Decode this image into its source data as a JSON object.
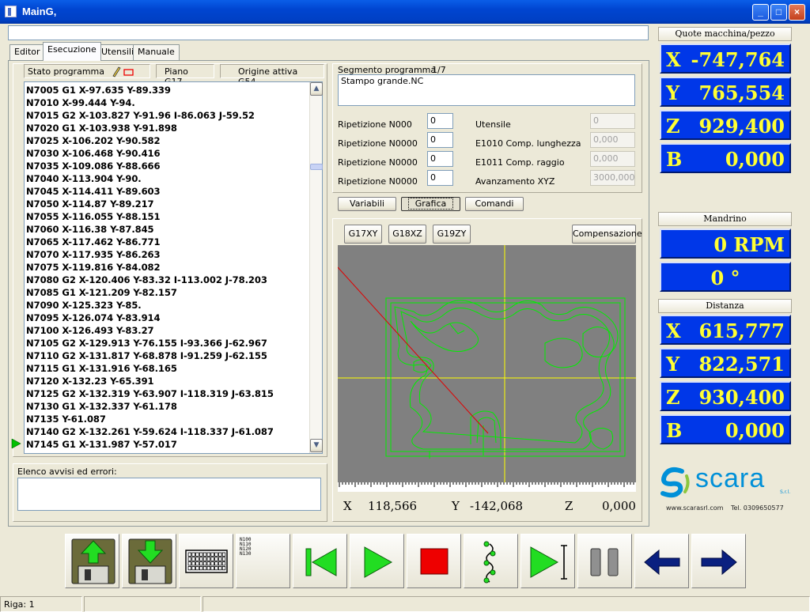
{
  "window": {
    "title": "MainG,",
    "min": "_",
    "max": "□",
    "close": "×"
  },
  "tabs": [
    "Editor",
    "Esecuzione",
    "Utensili",
    "Manuale"
  ],
  "program_bar": {
    "stato": "Stato programma",
    "piano": "Piano G17",
    "origine": "Origine attiva G54"
  },
  "code_lines": [
    "N7005 G1 X-97.635 Y-89.339",
    "N7010 X-99.444 Y-94.",
    "N7015 G2 X-103.827 Y-91.96 I-86.063 J-59.52",
    "N7020 G1 X-103.938 Y-91.898",
    "N7025 X-106.202 Y-90.582",
    "N7030 X-106.468 Y-90.416",
    "N7035 X-109.086 Y-88.666",
    "N7040 X-113.904 Y-90.",
    "N7045 X-114.411 Y-89.603",
    "N7050 X-114.87 Y-89.217",
    "N7055 X-116.055 Y-88.151",
    "N7060 X-116.38 Y-87.845",
    "N7065 X-117.462 Y-86.771",
    "N7070 X-117.935 Y-86.263",
    "N7075 X-119.816 Y-84.082",
    "N7080 G2 X-120.406 Y-83.32 I-113.002 J-78.203",
    "N7085 G1 X-121.209 Y-82.157",
    "N7090 X-125.323 Y-85.",
    "N7095 X-126.074 Y-83.914",
    "N7100 X-126.493 Y-83.27",
    "N7105 G2 X-129.913 Y-76.155 I-93.366 J-62.967",
    "N7110 G2 X-131.817 Y-68.878 I-91.259 J-62.155",
    "N7115 G1 X-131.916 Y-68.165",
    "N7120 X-132.23 Y-65.391",
    "N7125 G2 X-132.319 Y-63.907 I-118.319 J-63.815",
    "N7130 G1 X-132.337 Y-61.178",
    "N7135 Y-61.087",
    "N7140 G2 X-132.261 Y-59.624 I-118.337 J-61.087",
    "N7145 G1 X-131.987 Y-57.017"
  ],
  "messages_label": "Elenco avvisi ed errori:",
  "segment": {
    "label": "Segmento programma",
    "count": "1/7",
    "file": "Stampo grande.NC"
  },
  "params": {
    "rows": [
      {
        "label": "Ripetizione N000",
        "value": "0"
      },
      {
        "label": "Ripetizione N0000",
        "value": "0"
      },
      {
        "label": "Ripetizione N0000",
        "value": "0"
      },
      {
        "label": "Ripetizione N0000",
        "value": "0"
      }
    ],
    "right": [
      {
        "label": "Utensile",
        "value": "0"
      },
      {
        "label": "E1010 Comp. lunghezza",
        "value": "0,000"
      },
      {
        "label": "E1011 Comp. raggio",
        "value": "0,000"
      },
      {
        "label": "Avanzamento XYZ",
        "value": "3000,000"
      }
    ]
  },
  "subtabs": [
    "Variabili",
    "Grafica",
    "Comandi"
  ],
  "plane_buttons": [
    "G17XY",
    "G18XZ",
    "G19ZY"
  ],
  "comp_button": "Compensazione",
  "coords": {
    "x_label": "X",
    "x": "118,566",
    "y_label": "Y",
    "y": "-142,068",
    "z_label": "Z",
    "z": "0,000"
  },
  "machine": {
    "header": "Quote macchina/pezzo",
    "rows": [
      {
        "axis": "X",
        "value": "-747,764"
      },
      {
        "axis": "Y",
        "value": "765,554"
      },
      {
        "axis": "Z",
        "value": "929,400"
      },
      {
        "axis": "B",
        "value": "0,000"
      }
    ]
  },
  "spindle": {
    "header": "Mandrino",
    "rpm": "0 RPM",
    "angle": "0 °"
  },
  "distance": {
    "header": "Distanza",
    "rows": [
      {
        "axis": "X",
        "value": "615,777"
      },
      {
        "axis": "Y",
        "value": "822,571"
      },
      {
        "axis": "Z",
        "value": "930,400"
      },
      {
        "axis": "B",
        "value": "0,000"
      }
    ]
  },
  "brand": {
    "name": "scara",
    "suffix": "S.r.l.",
    "site": "www.scarasrl.com",
    "tel": "Tel. 0309650577"
  },
  "block_labels": [
    "N100",
    "N110",
    "N120",
    "N130"
  ],
  "statusbar": {
    "riga": "Riga: 1"
  },
  "colors": {
    "readout_bg": "#0037e8",
    "readout_text": "#ffff33",
    "toolpath": "#00e000",
    "graphics_bg": "#808080"
  }
}
